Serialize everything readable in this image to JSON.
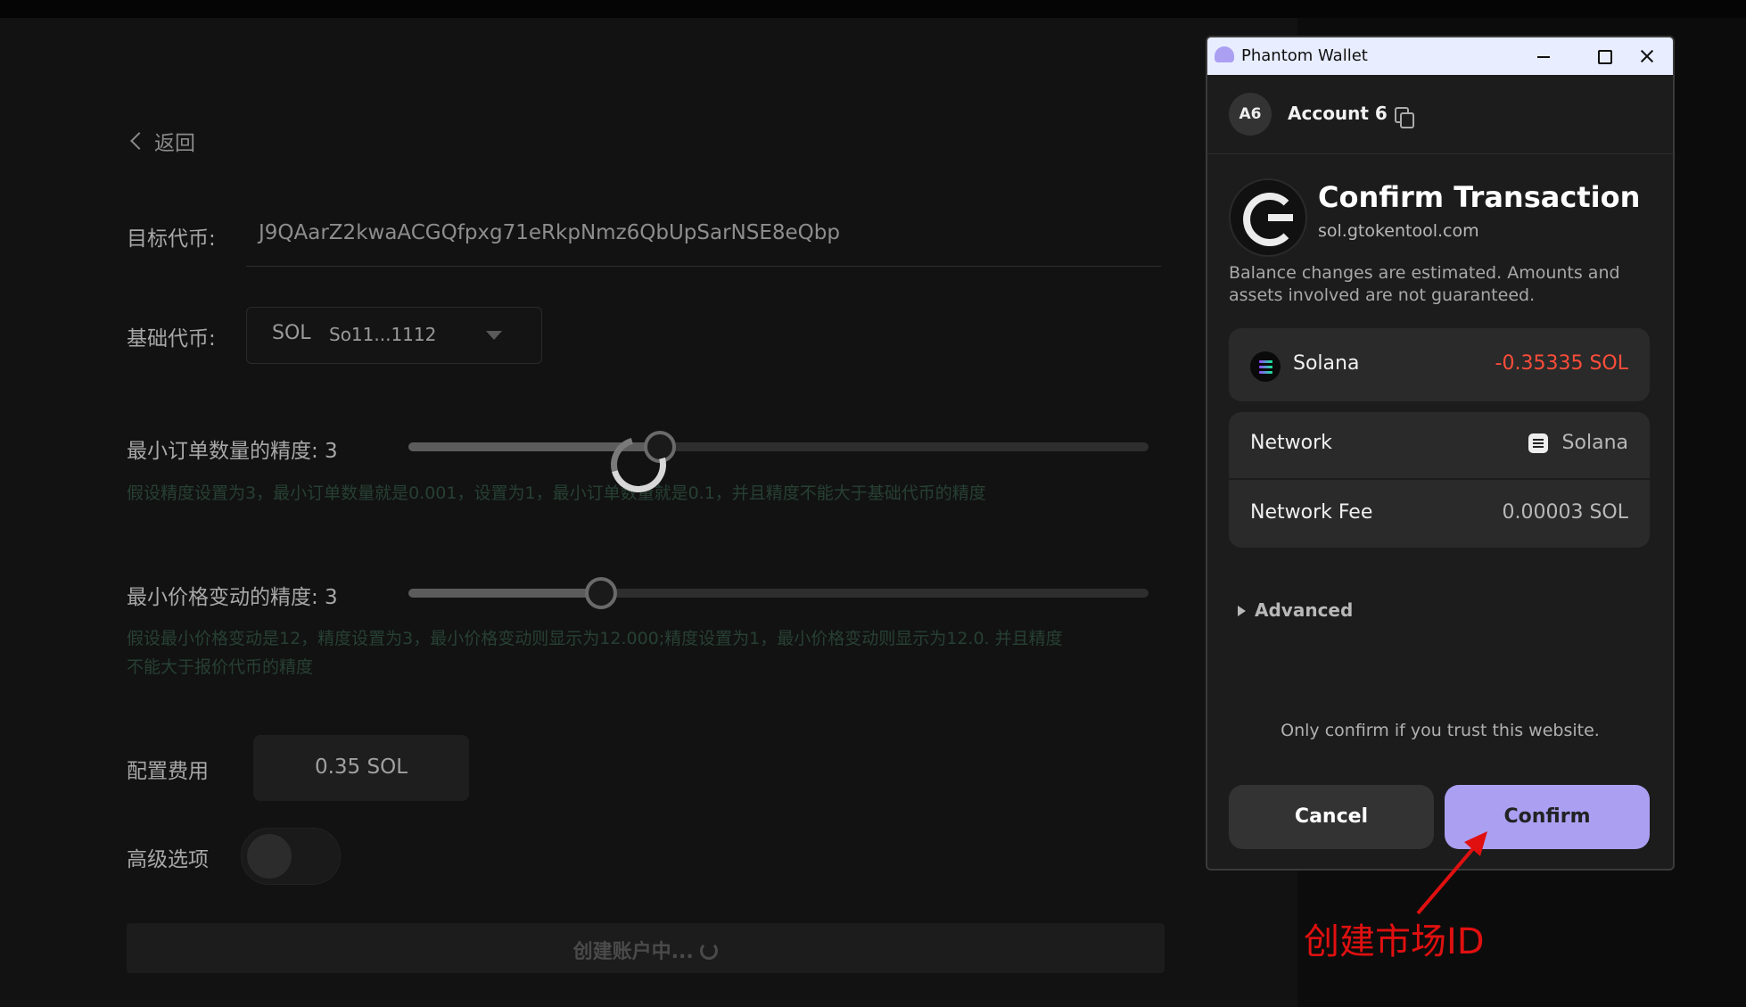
{
  "form": {
    "back": "返回",
    "target_label": "目标代币:",
    "target_value": "J9QAarZ2kwaACGQfpxg71eRkpNmz6QbUpSarNSE8eQbp",
    "base_label": "基础代币:",
    "base_symbol": "SOL",
    "base_addr": "So11...1112",
    "order_precision_label": "最小订单数量的精度: 3",
    "order_precision_value": 3,
    "order_hint": "假设精度设置为3，最小订单数量就是0.001，设置为1，最小订单数量就是0.1，并且精度不能大于基础代币的精度",
    "price_precision_label": "最小价格变动的精度: 3",
    "price_precision_value": 3,
    "price_hint_1": "假设最小价格变动是12，精度设置为3，最小价格变动则显示为12.000;精度设置为1，最小价格变动则显示为12.0. 并且精度",
    "price_hint_2": "不能大于报价代币的精度",
    "fee_label": "配置费用",
    "fee_value": "0.35 SOL",
    "advanced_label": "高级选项",
    "submit": "创建账户中..."
  },
  "wallet": {
    "title": "Phantom Wallet",
    "avatar": "A6",
    "account": "Account 6",
    "confirm_title": "Confirm Transaction",
    "site": "sol.gtokentool.com",
    "note": "Balance changes are estimated. Amounts and assets involved are not guaranteed.",
    "asset_name": "Solana",
    "asset_change": "-0.35335 SOL",
    "network_label": "Network",
    "network_value": "Solana",
    "fee_label": "Network Fee",
    "fee_value": "0.00003 SOL",
    "advanced": "Advanced",
    "trust": "Only confirm if you trust this website.",
    "cancel": "Cancel",
    "confirm": "Confirm"
  },
  "annotation": "创建市场ID",
  "colors": {
    "accent": "#ab9ff2",
    "negative": "#ff4d3a",
    "annotation": "#e01010"
  }
}
